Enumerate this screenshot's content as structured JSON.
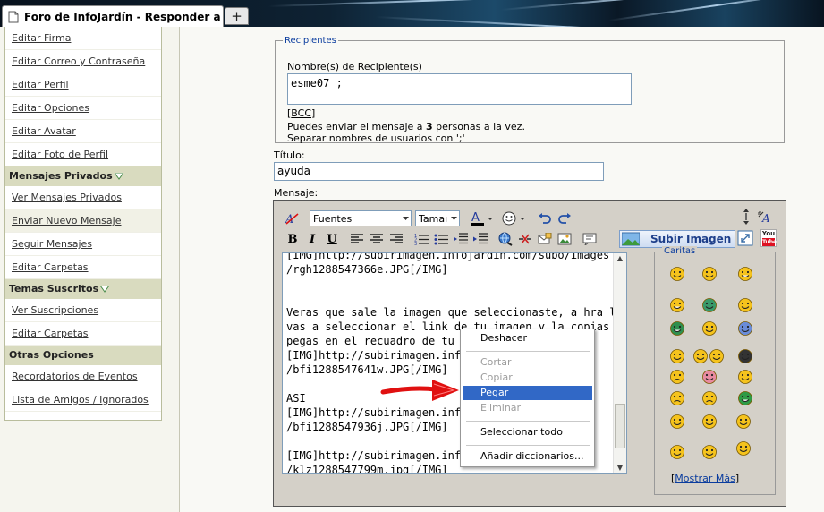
{
  "browser": {
    "tab_title": "Foro de InfoJardín - Responder a Me...",
    "new_tab": "+"
  },
  "sidebar": {
    "rows": [
      {
        "type": "link",
        "label": "Editar Firma"
      },
      {
        "type": "link",
        "label": "Editar Correo y Contraseña"
      },
      {
        "type": "link",
        "label": "Editar Perfil"
      },
      {
        "type": "link",
        "label": "Editar Opciones"
      },
      {
        "type": "link",
        "label": "Editar Avatar"
      },
      {
        "type": "link",
        "label": "Editar Foto de Perfil"
      },
      {
        "type": "head",
        "label": "Mensajes Privados",
        "arrow": true
      },
      {
        "type": "link",
        "label": "Ver Mensajes Privados"
      },
      {
        "type": "link",
        "label": "Enviar Nuevo Mensaje",
        "highlight": true
      },
      {
        "type": "link",
        "label": "Seguir Mensajes"
      },
      {
        "type": "link",
        "label": "Editar Carpetas"
      },
      {
        "type": "head",
        "label": "Temas Suscritos",
        "arrow": true
      },
      {
        "type": "link",
        "label": "Ver Suscripciones"
      },
      {
        "type": "link",
        "label": "Editar Carpetas"
      },
      {
        "type": "head",
        "label": "Otras Opciones",
        "arrow": false
      },
      {
        "type": "link",
        "label": "Recordatorios de Eventos"
      },
      {
        "type": "link",
        "label": "Lista de Amigos / Ignorados"
      }
    ]
  },
  "recipients": {
    "legend": "Recipientes",
    "label": "Nombre(s) de Recipiente(s)",
    "value": "esme07 ;",
    "bcc_open": "[",
    "bcc": "BCC",
    "bcc_close": "]",
    "note_prefix": "Puedes enviar el mensaje a ",
    "note_count": "3",
    "note_suffix": " personas a la vez.",
    "separator_note": "Separar nombres de usuarios con ';'"
  },
  "title_field": {
    "label": "Título:",
    "value": "ayuda"
  },
  "message": {
    "label": "Mensaje:",
    "font_select": "Fuentes",
    "size_select": "Tamaı",
    "upload_button": "Subir Imagen",
    "youtube_top": "You",
    "youtube_bottom": "Tube",
    "body": "[IMG]http://subirimagen.infojardin.com/subo/images\n/rgh1288547366e.JPG[/IMG]\n\n\nVeras que sale la imagen que seleccionaste, a hra le\nvas a seleccionar el link de tu imagen y la copias y la\npegas en el recuadro de tu m\n[IMG]http://subirimagen.infoj\n/bfi1288547641w.JPG[/IMG]\n\nASI\n[IMG]http://subirimagen.infoj\n/bfi1288547936j.JPG[/IMG]\n\n[IMG]http://subirimagen.infoj\n/klz1288547799m.jpg[/IMG]"
  },
  "smilies": {
    "legend": "Caritas",
    "more_open": "[",
    "more": "Mostrar Más",
    "more_close": "]"
  },
  "context_menu": {
    "items": [
      {
        "label": "Deshacer",
        "state": "enabled"
      },
      {
        "label": "Cortar",
        "state": "disabled"
      },
      {
        "label": "Copiar",
        "state": "disabled"
      },
      {
        "label": "Pegar",
        "state": "selected"
      },
      {
        "label": "Eliminar",
        "state": "disabled"
      },
      {
        "label": "Seleccionar todo",
        "state": "enabled"
      },
      {
        "label": "Añadir diccionarios...",
        "state": "enabled"
      }
    ]
  },
  "colors": {
    "sidebar_header": "#d9dbbf",
    "menu_highlight": "#3168c6",
    "link_blue": "#0a3c9e",
    "annotation_arrow": "#e01010"
  }
}
